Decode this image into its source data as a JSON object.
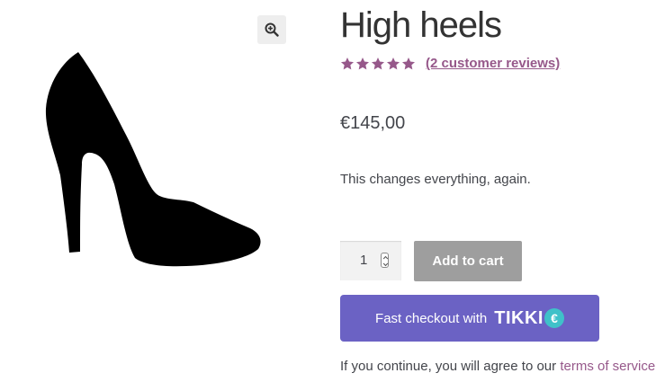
{
  "product": {
    "title": "High heels",
    "rating": 5,
    "rating_max": 5,
    "review_link": "(2 customer reviews)",
    "price": "€145,00",
    "description": "This changes everything, again."
  },
  "gallery": {
    "zoom_icon": "zoom-in-icon",
    "image_subject": "black high heel shoe silhouette"
  },
  "cart": {
    "quantity": "1",
    "add_label": "Add to cart"
  },
  "fast_checkout": {
    "label": "Fast checkout with",
    "brand": "TIKKI",
    "badge": "€"
  },
  "terms": {
    "prefix": "If you continue, you will agree to our ",
    "link": "terms of service"
  },
  "colors": {
    "accent": "#96588a",
    "checkout": "#6b62c4",
    "tikki_badge": "#3fc1c9",
    "cart_button": "#9e9e9e"
  }
}
